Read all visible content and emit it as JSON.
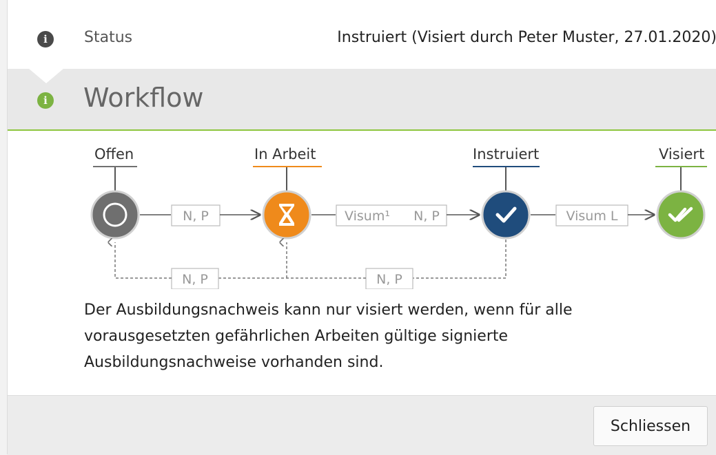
{
  "status": {
    "icon": "info-circle-icon",
    "label": "Status",
    "value": "Instruiert (Visiert durch Peter Muster, 27.01.2020)"
  },
  "workflow": {
    "icon": "info-circle-icon",
    "title": "Workflow",
    "steps": [
      {
        "label": "Offen",
        "color": "#707070",
        "icon": "circle-open-icon"
      },
      {
        "label": "In Arbeit",
        "color": "#ef8a1b",
        "icon": "hourglass-icon"
      },
      {
        "label": "Instruiert",
        "color": "#1f4c7c",
        "icon": "check-icon"
      },
      {
        "label": "Visiert",
        "color": "#7cb342",
        "icon": "double-check-icon"
      }
    ],
    "transitions_forward": [
      {
        "label": "N, P"
      },
      {
        "label_a": "Visum¹",
        "label_b": "N, P"
      },
      {
        "label": "Visum L"
      }
    ],
    "transitions_back": [
      {
        "label": "N, P"
      },
      {
        "label": "N, P"
      }
    ],
    "description": "Der Ausbildungsnachweis kann nur visiert werden, wenn für alle vorausgesetzten gefährlichen Arbeiten gültige signierte Ausbildungsnachweise vorhanden sind."
  },
  "footer": {
    "close_label": "Schliessen"
  }
}
